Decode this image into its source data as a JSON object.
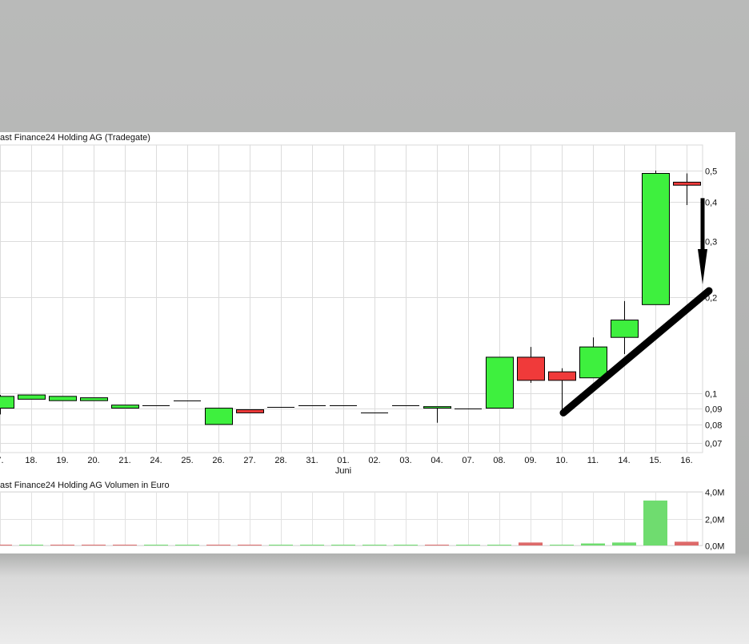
{
  "chart_data": [
    {
      "type": "candlestick",
      "title": "ast Finance24 Holding AG (Tradegate)",
      "x_labels": [
        "7.",
        "18.",
        "19.",
        "20.",
        "21.",
        "24.",
        "25.",
        "26.",
        "27.",
        "28.",
        "31.",
        "01.",
        "02.",
        "03.",
        "04.",
        "07.",
        "08.",
        "09.",
        "10.",
        "11.",
        "14.",
        "15.",
        "16."
      ],
      "month_label": "Juni",
      "y_scale": "log",
      "y_ticks": [
        0.5,
        0.4,
        0.3,
        0.2,
        0.1,
        0.09,
        0.08,
        0.07
      ],
      "y_tick_labels": [
        "0,5",
        "0,4",
        "0,3",
        "0,2",
        "0,1",
        "0,09",
        "0,08",
        "0,07"
      ],
      "ylim": [
        0.065,
        0.6
      ],
      "candles": [
        {
          "x": "7.",
          "open": 0.09,
          "high": 0.099,
          "low": 0.086,
          "close": 0.098
        },
        {
          "x": "18.",
          "open": 0.096,
          "high": 0.099,
          "low": 0.096,
          "close": 0.099
        },
        {
          "x": "19.",
          "open": 0.095,
          "high": 0.098,
          "low": 0.095,
          "close": 0.098
        },
        {
          "x": "20.",
          "open": 0.095,
          "high": 0.097,
          "low": 0.095,
          "close": 0.097
        },
        {
          "x": "21.",
          "open": 0.09,
          "high": 0.092,
          "low": 0.09,
          "close": 0.092
        },
        {
          "x": "24.",
          "open": 0.092,
          "high": 0.092,
          "low": 0.092,
          "close": 0.092
        },
        {
          "x": "25.",
          "open": 0.095,
          "high": 0.095,
          "low": 0.095,
          "close": 0.095
        },
        {
          "x": "26.",
          "open": 0.08,
          "high": 0.09,
          "low": 0.08,
          "close": 0.09
        },
        {
          "x": "27.",
          "open": 0.089,
          "high": 0.089,
          "low": 0.087,
          "close": 0.087
        },
        {
          "x": "28.",
          "open": 0.091,
          "high": 0.091,
          "low": 0.091,
          "close": 0.091
        },
        {
          "x": "31.",
          "open": 0.092,
          "high": 0.092,
          "low": 0.092,
          "close": 0.092
        },
        {
          "x": "01.",
          "open": 0.092,
          "high": 0.092,
          "low": 0.092,
          "close": 0.092
        },
        {
          "x": "02.",
          "open": 0.087,
          "high": 0.087,
          "low": 0.087,
          "close": 0.087
        },
        {
          "x": "03.",
          "open": 0.092,
          "high": 0.092,
          "low": 0.092,
          "close": 0.092
        },
        {
          "x": "04.",
          "open": 0.09,
          "high": 0.091,
          "low": 0.081,
          "close": 0.091
        },
        {
          "x": "07.",
          "open": 0.09,
          "high": 0.09,
          "low": 0.09,
          "close": 0.09
        },
        {
          "x": "08.",
          "open": 0.09,
          "high": 0.13,
          "low": 0.09,
          "close": 0.13
        },
        {
          "x": "09.",
          "open": 0.13,
          "high": 0.14,
          "low": 0.108,
          "close": 0.11
        },
        {
          "x": "10.",
          "open": 0.117,
          "high": 0.12,
          "low": 0.087,
          "close": 0.11
        },
        {
          "x": "11.",
          "open": 0.112,
          "high": 0.15,
          "low": 0.112,
          "close": 0.14
        },
        {
          "x": "14.",
          "open": 0.15,
          "high": 0.195,
          "low": 0.133,
          "close": 0.17
        },
        {
          "x": "15.",
          "open": 0.19,
          "high": 0.5,
          "low": 0.19,
          "close": 0.49
        },
        {
          "x": "16.",
          "open": 0.46,
          "high": 0.49,
          "low": 0.39,
          "close": 0.45
        }
      ],
      "annotations": [
        {
          "type": "trendline",
          "from": {
            "x": "10.",
            "y": 0.087
          },
          "to": {
            "x": "16.",
            "y": 0.21
          }
        },
        {
          "type": "arrow",
          "direction": "down",
          "x": "16.",
          "from_y": 0.41,
          "to_y": 0.22
        }
      ],
      "colors": {
        "up": "#3ef03e",
        "down": "#f03a3a",
        "grid": "#dcdcdc",
        "annotation": "#000000"
      },
      "grid": true
    },
    {
      "type": "bar",
      "title": "ast Finance24 Holding AG Volumen in Euro",
      "categories": [
        "7.",
        "18.",
        "19.",
        "20.",
        "21.",
        "24.",
        "25.",
        "26.",
        "27.",
        "28.",
        "31.",
        "01.",
        "02.",
        "03.",
        "04.",
        "07.",
        "08.",
        "09.",
        "10.",
        "11.",
        "14.",
        "15.",
        "16."
      ],
      "values": [
        0.02,
        0.01,
        0.02,
        0.02,
        0.02,
        0,
        0,
        0.02,
        0.02,
        0,
        0,
        0,
        0,
        0,
        0.02,
        0,
        0.02,
        0.22,
        0.03,
        0.15,
        0.22,
        3.35,
        0.28
      ],
      "directions": [
        "down",
        "up",
        "down",
        "down",
        "down",
        "up",
        "up",
        "down",
        "down",
        "up",
        "up",
        "up",
        "up",
        "up",
        "down",
        "up",
        "up",
        "down",
        "up",
        "up",
        "up",
        "up",
        "down"
      ],
      "y_ticks": [
        0,
        2,
        4
      ],
      "y_tick_labels": [
        "0,0M",
        "2,0M",
        "4,0M"
      ],
      "ylim": [
        0,
        4
      ],
      "colors": {
        "up": "#6fdc6f",
        "down": "#dd6a6a"
      },
      "grid": true
    }
  ]
}
